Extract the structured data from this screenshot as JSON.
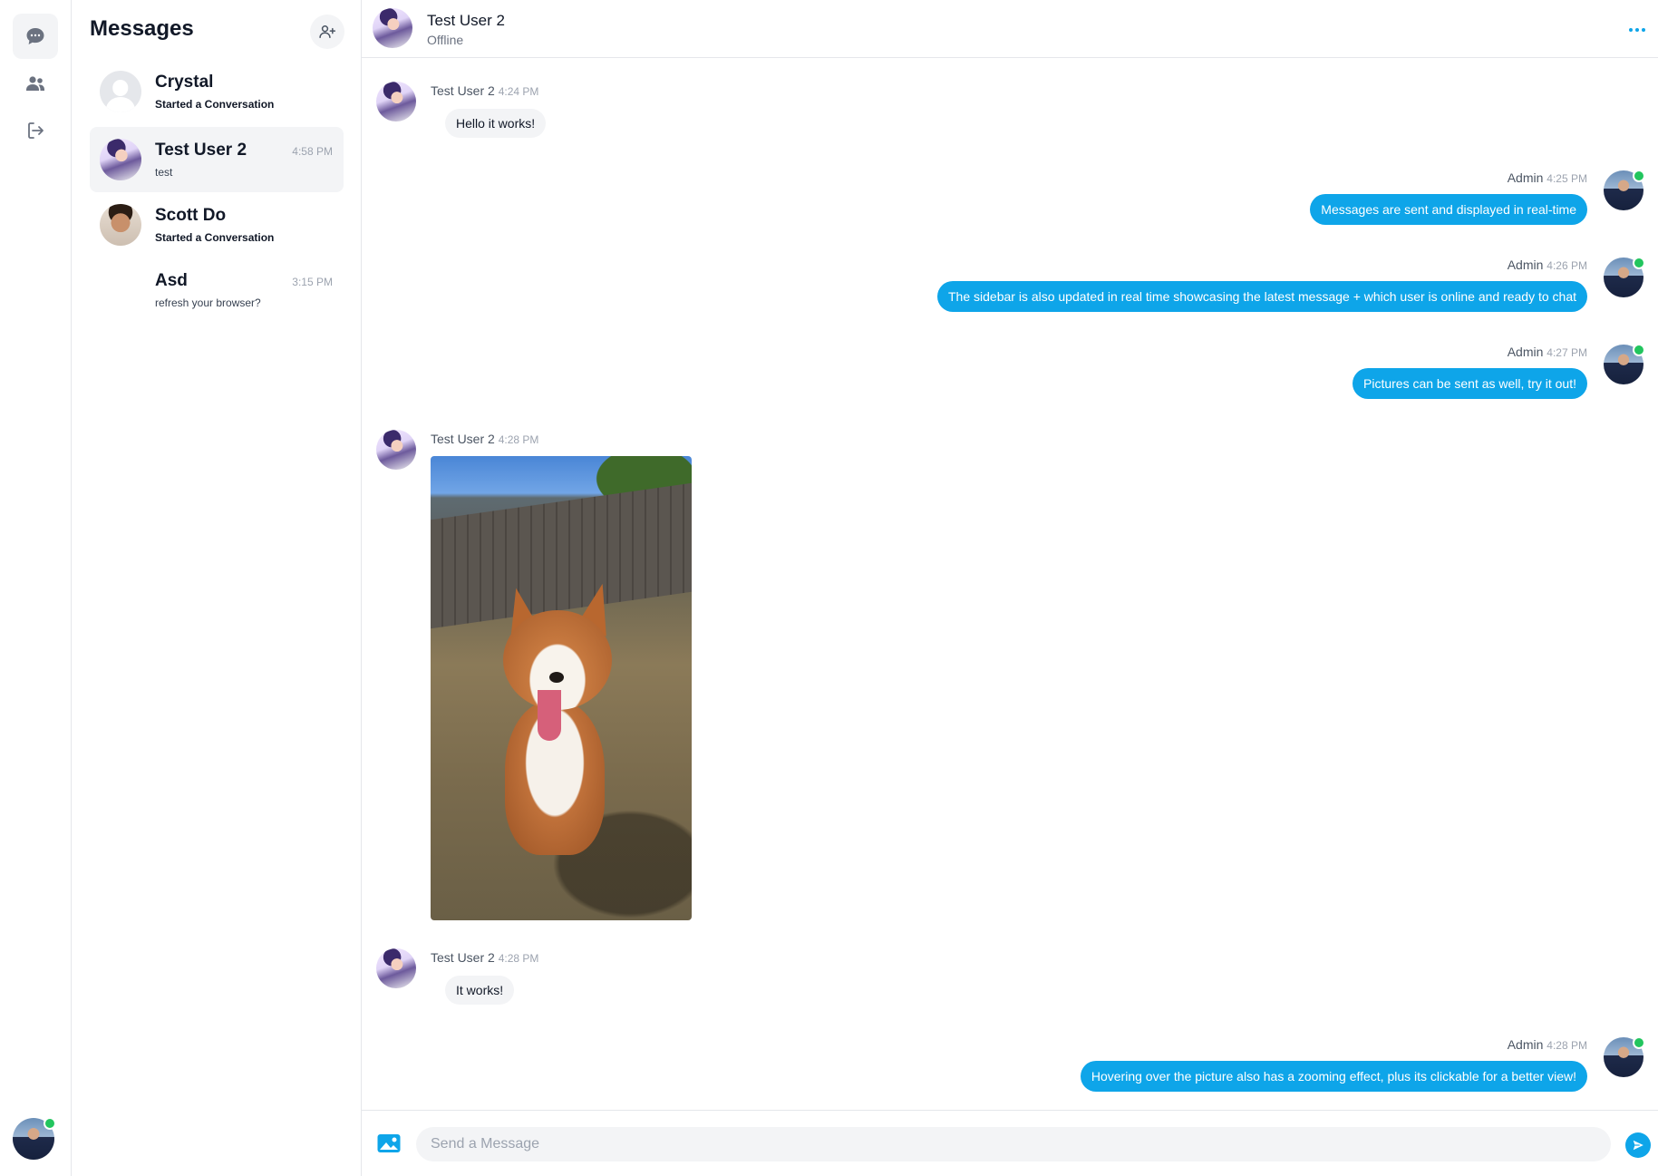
{
  "sidebar": {
    "title": "Messages",
    "conversations": [
      {
        "name": "Crystal",
        "subtitle": "Started a Conversation",
        "time": ""
      },
      {
        "name": "Test User 2",
        "subtitle": "test",
        "time": "4:58 PM"
      },
      {
        "name": "Scott Do",
        "subtitle": "Started a Conversation",
        "time": ""
      },
      {
        "name": "Asd",
        "subtitle": "refresh your browser?",
        "time": "3:15 PM"
      }
    ]
  },
  "chat": {
    "title": "Test User 2",
    "status": "Offline",
    "messages": [
      {
        "sender": "Test User 2",
        "time": "4:24 PM",
        "text": "Hello it works!"
      },
      {
        "sender": "Admin",
        "time": "4:25 PM",
        "text": "Messages are sent and displayed in real-time"
      },
      {
        "sender": "Admin",
        "time": "4:26 PM",
        "text": "The sidebar is also updated in real time showcasing the latest message + which user is online and ready to chat"
      },
      {
        "sender": "Admin",
        "time": "4:27 PM",
        "text": "Pictures can be sent as well, try it out!"
      },
      {
        "sender": "Test User 2",
        "time": "4:28 PM",
        "text": ""
      },
      {
        "sender": "Test User 2",
        "time": "4:28 PM",
        "text": "It works!"
      },
      {
        "sender": "Admin",
        "time": "4:28 PM",
        "text": "Hovering over the picture also has a zooming effect, plus its clickable for a better view!"
      }
    ]
  },
  "composer": {
    "placeholder": "Send a Message"
  },
  "icons": {
    "rail": [
      "chat-bubble-icon",
      "users-icon",
      "logout-icon"
    ],
    "add_contact": "user-plus-icon",
    "more": "more-dots-icon",
    "attach": "image-icon",
    "send": "send-icon"
  },
  "colors": {
    "accent": "#0ea5e9",
    "online": "#22c55e",
    "incoming_bubble": "#f3f4f6"
  }
}
